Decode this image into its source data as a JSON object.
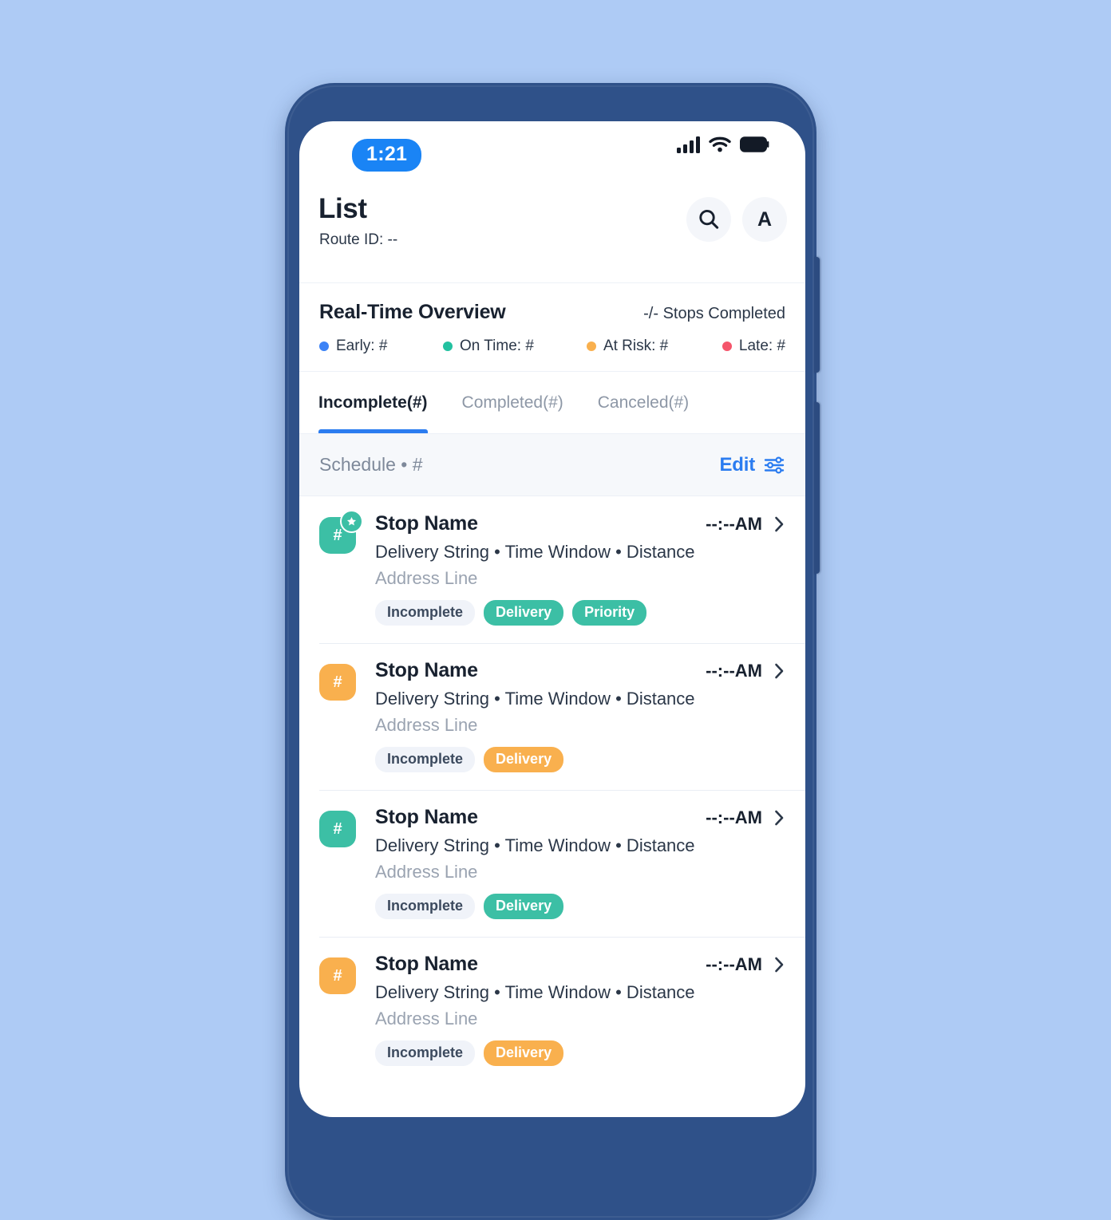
{
  "status_bar": {
    "time": "1:21",
    "signal_icon": "cellular-signal-icon",
    "wifi_icon": "wifi-icon",
    "battery_icon": "battery-full-icon"
  },
  "header": {
    "title": "List",
    "route_id": "Route ID: --",
    "search_icon": "search-icon",
    "avatar_initial": "A"
  },
  "overview": {
    "title": "Real-Time Overview",
    "stops_completed": "-/- Stops Completed",
    "legend": [
      {
        "label": "Early: #",
        "color": "#3b82f6"
      },
      {
        "label": "On Time: #",
        "color": "#22c1a0"
      },
      {
        "label": "At Risk: #",
        "color": "#f9b04e"
      },
      {
        "label": "Late: #",
        "color": "#f5556b"
      }
    ]
  },
  "tabs": [
    {
      "label": "Incomplete(#)",
      "active": true
    },
    {
      "label": "Completed(#)",
      "active": false
    },
    {
      "label": "Canceled(#)",
      "active": false
    }
  ],
  "schedule_bar": {
    "label": "Schedule • #",
    "edit_label": "Edit",
    "filter_icon": "sliders-filter-icon"
  },
  "stops": [
    {
      "marker": "#",
      "marker_color": "#3cbfa5",
      "priority_star": true,
      "star_icon": "star-icon",
      "name": "Stop Name",
      "eta": "--:--AM",
      "chevron_icon": "chevron-right-icon",
      "detail": "Delivery String • Time Window • Distance",
      "address": "Address Line",
      "chips": [
        {
          "label": "Incomplete",
          "style": "chip-status"
        },
        {
          "label": "Delivery",
          "style": "chip-teal"
        },
        {
          "label": "Priority",
          "style": "chip-teal"
        }
      ]
    },
    {
      "marker": "#",
      "marker_color": "#f9b04e",
      "priority_star": false,
      "star_icon": "star-icon",
      "name": "Stop Name",
      "eta": "--:--AM",
      "chevron_icon": "chevron-right-icon",
      "detail": "Delivery String • Time Window • Distance",
      "address": "Address Line",
      "chips": [
        {
          "label": "Incomplete",
          "style": "chip-status"
        },
        {
          "label": "Delivery",
          "style": "chip-amber"
        }
      ]
    },
    {
      "marker": "#",
      "marker_color": "#3cbfa5",
      "priority_star": false,
      "star_icon": "star-icon",
      "name": "Stop Name",
      "eta": "--:--AM",
      "chevron_icon": "chevron-right-icon",
      "detail": "Delivery String • Time Window • Distance",
      "address": "Address Line",
      "chips": [
        {
          "label": "Incomplete",
          "style": "chip-status"
        },
        {
          "label": "Delivery",
          "style": "chip-teal"
        }
      ]
    },
    {
      "marker": "#",
      "marker_color": "#f9b04e",
      "priority_star": false,
      "star_icon": "star-icon",
      "name": "Stop Name",
      "eta": "--:--AM",
      "chevron_icon": "chevron-right-icon",
      "detail": "Delivery String • Time Window • Distance",
      "address": "Address Line",
      "chips": [
        {
          "label": "Incomplete",
          "style": "chip-status"
        },
        {
          "label": "Delivery",
          "style": "chip-amber"
        }
      ]
    }
  ],
  "theme": {
    "page_background": "#aecbf5",
    "phone_frame": "#2f5189",
    "accent_blue": "#2b7cf0",
    "teal": "#3cbfa5",
    "amber": "#f9b04e"
  }
}
